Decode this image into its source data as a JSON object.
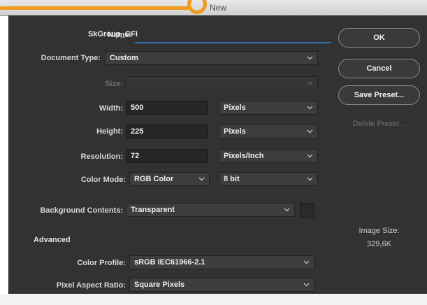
{
  "window": {
    "title": "New"
  },
  "form": {
    "name": {
      "label": "Name:",
      "value": "SkGroup_GFI"
    },
    "document_type": {
      "label": "Document Type:",
      "value": "Custom"
    },
    "size": {
      "label": "Size:",
      "value": ""
    },
    "width": {
      "label": "Width:",
      "value": "500",
      "unit": "Pixels"
    },
    "height": {
      "label": "Height:",
      "value": "225",
      "unit": "Pixels"
    },
    "resolution": {
      "label": "Resolution:",
      "value": "72",
      "unit": "Pixels/Inch"
    },
    "color_mode": {
      "label": "Color Mode:",
      "value": "RGB Color",
      "depth": "8 bit"
    },
    "background_contents": {
      "label": "Background Contents:",
      "value": "Transparent"
    }
  },
  "advanced": {
    "title": "Advanced",
    "color_profile": {
      "label": "Color Profile:",
      "value": "sRGB IEC61966-2.1"
    },
    "pixel_aspect_ratio": {
      "label": "Pixel Aspect Ratio:",
      "value": "Square Pixels"
    }
  },
  "buttons": {
    "ok": "OK",
    "cancel": "Cancel",
    "save_preset": "Save Preset...",
    "delete_preset": "Delete Preset..."
  },
  "image_size": {
    "label": "Image Size:",
    "value": "329,6K"
  },
  "colors": {
    "dialog_bg": "#323232",
    "highlight": "#f29a1d",
    "focus": "#2f6fb3"
  }
}
